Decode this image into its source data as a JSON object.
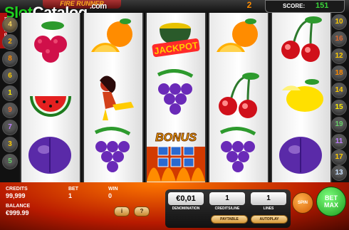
{
  "logo": {
    "text_slot": "Slot",
    "text_catalog": "Catalog",
    "suffix": ".com"
  },
  "title_banner": "FIRE RUNNER",
  "top_num": "2",
  "score": {
    "label": "SCORE:",
    "value": "151"
  },
  "report": "REPORT GAME",
  "left_lines": [
    "4",
    "2",
    "8",
    "6",
    "1",
    "9",
    "7",
    "3",
    "5"
  ],
  "right_lines": [
    "10",
    "16",
    "12",
    "18",
    "14",
    "15",
    "19",
    "11",
    "17",
    "13"
  ],
  "bonus_text": "BONUS",
  "jackpot_text": "JACKPOT",
  "info": {
    "credits_label": "CREDITS",
    "credits_value": "99,999",
    "bet_label": "BET",
    "bet_value": "1",
    "win_label": "WIN",
    "win_value": "0",
    "balance_label": "BALANCE",
    "balance_value": "€999.99"
  },
  "controls": {
    "denomination_value": "€0,01",
    "denomination_label": "DENOMINATION",
    "credits_line_value": "1",
    "credits_line_label": "CREDITS/LINE",
    "lines_value": "1",
    "lines_label": "LINES",
    "paytable": "PAYTABLE",
    "autoplay": "AUTOPLAY",
    "spin": "SPIN",
    "bet": "BET",
    "max": "MAX",
    "help": "?",
    "info_btn": "i"
  }
}
